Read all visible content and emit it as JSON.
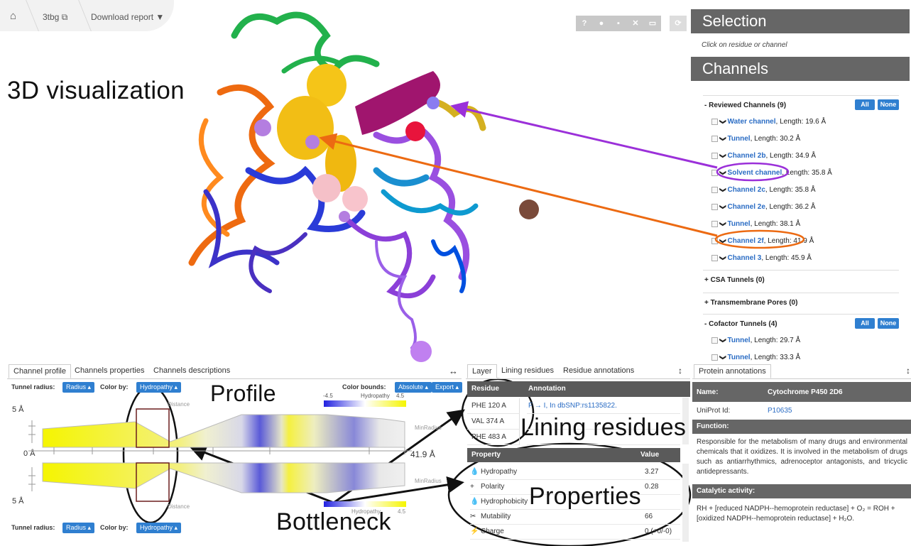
{
  "breadcrumb": {
    "pdb_id": "3tbg",
    "download": "Download report"
  },
  "viewer": {
    "label": "3D visualization",
    "toolbar": [
      "?",
      "⚙",
      "📷",
      "✕",
      "▭",
      "⟳"
    ]
  },
  "selection": {
    "title": "Selection",
    "hint": "Click on residue or channel"
  },
  "channels": {
    "title": "Channels",
    "reviewed": {
      "label": "Reviewed Channels (9)",
      "all": "All",
      "none": "None",
      "items": [
        {
          "name": "Water channel",
          "len": "Length: 19.6 Å"
        },
        {
          "name": "Tunnel",
          "len": "Length: 30.2 Å"
        },
        {
          "name": "Channel 2b",
          "len": "Length: 34.9 Å"
        },
        {
          "name": "Solvent channel",
          "len": "Length: 35.8 Å"
        },
        {
          "name": "Channel 2c",
          "len": "Length: 35.8 Å"
        },
        {
          "name": "Channel 2e",
          "len": "Length: 36.2 Å"
        },
        {
          "name": "Tunnel",
          "len": "Length: 38.1 Å"
        },
        {
          "name": "Channel 2f",
          "len": "Length: 41.9 Å"
        },
        {
          "name": "Channel 3",
          "len": "Length: 45.9 Å"
        }
      ]
    },
    "csa": "CSA Tunnels (0)",
    "tm": "Transmembrane Pores (0)",
    "cofactor": {
      "label": "Cofactor Tunnels (4)",
      "all": "All",
      "none": "None",
      "items": [
        {
          "name": "Tunnel",
          "len": "Length: 29.7 Å"
        },
        {
          "name": "Tunnel",
          "len": "Length: 33.3 Å"
        }
      ]
    }
  },
  "profile": {
    "tabs": [
      "Channel profile",
      "Channels properties",
      "Channels descriptions"
    ],
    "tunnel_radius": "Tunnel radius:",
    "radius_btn": "Radius ▴",
    "color_by": "Color by:",
    "hydro_btn": "Hydropathy ▴",
    "color_bounds": "Color bounds:",
    "absolute_btn": "Absolute ▴",
    "export_btn": "Export ▴",
    "scale_min": "-4.5",
    "scale_label": "Hydropathy",
    "scale_max": "4.5",
    "y_top": "5 Å",
    "y_mid": "0 Å",
    "y_bot": "5 Å",
    "length": "41.9 Å",
    "distance": "Distance",
    "minradius": "MinRadius",
    "label": "Profile",
    "bottleneck": "Bottleneck"
  },
  "lining": {
    "tabs": [
      "Layer",
      "Lining residues",
      "Residue annotations"
    ],
    "col_residue": "Residue",
    "col_annotation": "Annotation",
    "rows": [
      {
        "res": "PHE 120 A",
        "anno": "F → I, In dbSNP:rs1135822."
      },
      {
        "res": "VAL 374 A",
        "anno": ""
      },
      {
        "res": "PHE 483 A",
        "anno": ""
      }
    ],
    "label": "Lining residues",
    "col_property": "Property",
    "col_value": "Value",
    "props": [
      {
        "icon": "💧",
        "name": "Hydropathy",
        "value": "3.27"
      },
      {
        "icon": "+",
        "name": "Polarity",
        "value": "0.28"
      },
      {
        "icon": "💧",
        "name": "Hydrophobicity",
        "value": ""
      },
      {
        "icon": "✂",
        "name": "Mutability",
        "value": "66"
      },
      {
        "icon": "⚡",
        "name": "Charge",
        "value": "0 (+0/-0)"
      }
    ],
    "props_label": "Properties"
  },
  "protein": {
    "tab": "Protein annotations",
    "name_label": "Name:",
    "name_value": "Cytochrome P450 2D6",
    "uniprot_label": "UniProt Id:",
    "uniprot_value": "P10635",
    "function_label": "Function:",
    "function_text": "Responsible for the metabolism of many drugs and environmental chemicals that it oxidizes. It is involved in the metabolism of drugs such as antiarrhythmics, adrenoceptor antagonists, and tricyclic antidepressants.",
    "catalytic_label": "Catalytic activity:",
    "catalytic_text": "RH + [reduced NADPH--hemoprotein reductase] + O₂ = ROH + [oxidized NADPH--hemoprotein reductase] + H₂O."
  }
}
